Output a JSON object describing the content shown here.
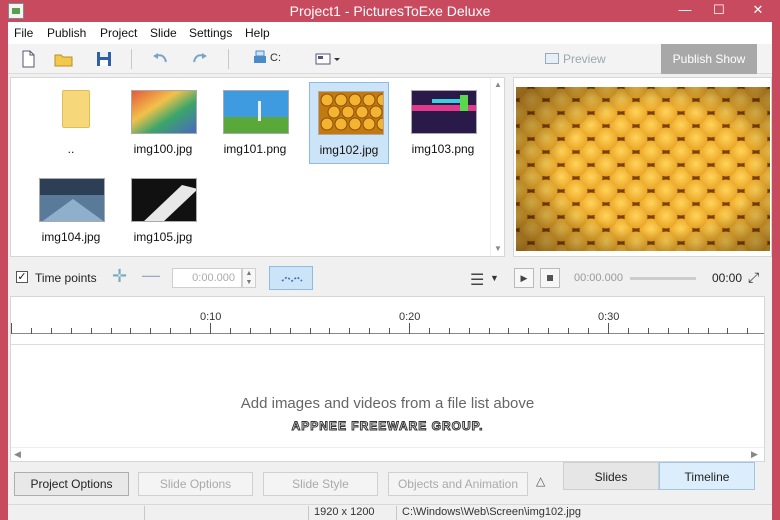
{
  "window": {
    "title": "Project1 - PicturesToExe Deluxe",
    "minimize": "—",
    "maximize": "☐",
    "close": "✕"
  },
  "menu": [
    "File",
    "Publish",
    "Project",
    "Slide",
    "Settings",
    "Help"
  ],
  "toolbar": {
    "preview_label": "Preview",
    "publish_label": "Publish Show",
    "drive_label": "C:"
  },
  "files": [
    {
      "name": "..",
      "type": "folder"
    },
    {
      "name": "img100.jpg",
      "type": "image"
    },
    {
      "name": "img101.png",
      "type": "image"
    },
    {
      "name": "img102.jpg",
      "type": "image",
      "selected": true
    },
    {
      "name": "img103.png",
      "type": "image"
    },
    {
      "name": "img104.jpg",
      "type": "image"
    },
    {
      "name": "img105.jpg",
      "type": "image"
    }
  ],
  "timeline_bar": {
    "time_points_label": "Time points",
    "time_points_checked": true,
    "time_value": "0:00.000",
    "player_current": "00:00.000",
    "player_end": "00:00"
  },
  "ruler_labels": [
    "0:10",
    "0:20",
    "0:30"
  ],
  "timeline": {
    "empty_message": "Add images and videos from a file list above",
    "watermark": "APPNEE FREEWARE GROUP."
  },
  "bottom": {
    "project_options": "Project Options",
    "slide_options": "Slide Options",
    "slide_style": "Slide Style",
    "objects_animation": "Objects and Animation",
    "tab_slides": "Slides",
    "tab_timeline": "Timeline"
  },
  "status": {
    "resolution": "1920 x 1200",
    "path": "C:\\Windows\\Web\\Screen\\img102.jpg"
  },
  "colors": {
    "titlebar": "#c84a5e",
    "selection": "#cce4f7",
    "publish_button": "#a8a8a8"
  }
}
